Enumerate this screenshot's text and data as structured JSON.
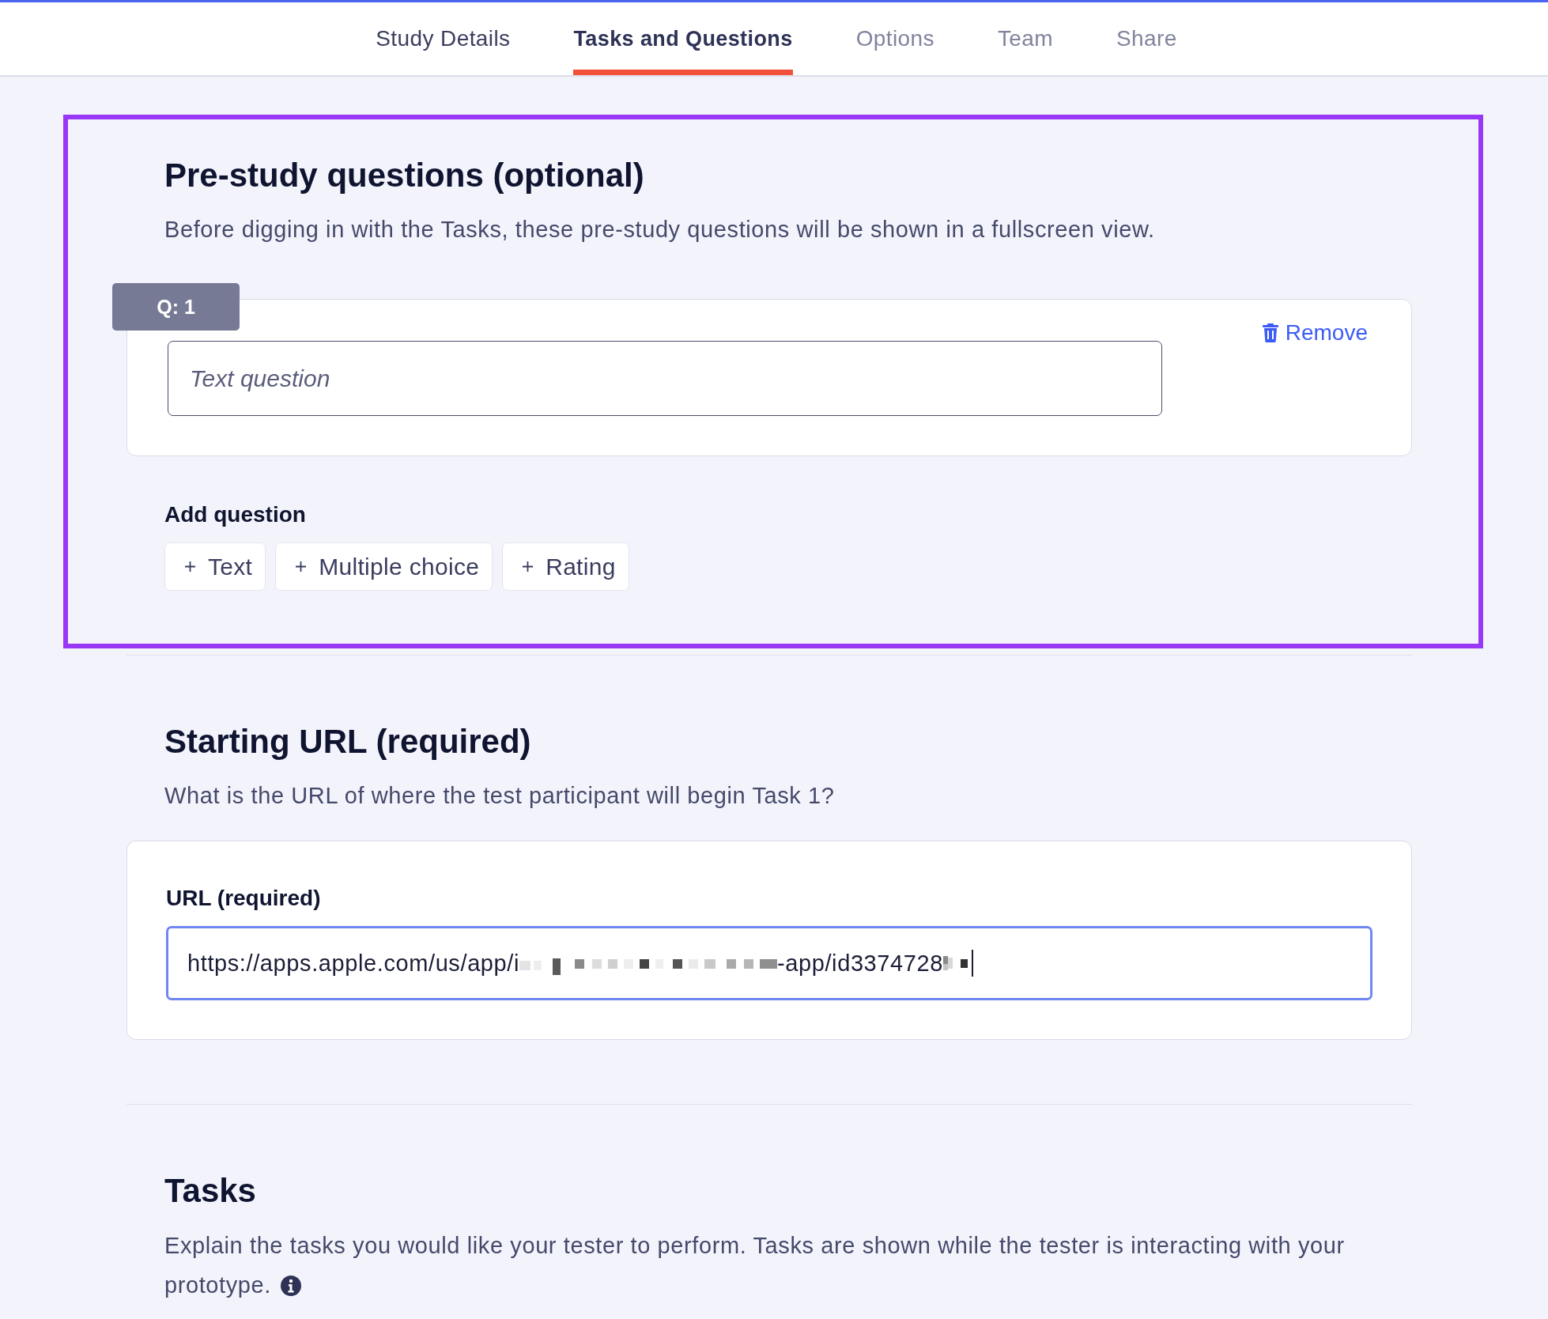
{
  "tabs": [
    {
      "label": "Study Details",
      "selected": false,
      "disabled": false
    },
    {
      "label": "Tasks and Questions",
      "selected": true,
      "disabled": false
    },
    {
      "label": "Options",
      "selected": false,
      "disabled": true
    },
    {
      "label": "Team",
      "selected": false,
      "disabled": true
    },
    {
      "label": "Share",
      "selected": false,
      "disabled": true
    }
  ],
  "pre_study": {
    "highlighted": true,
    "title": "Pre-study questions (optional)",
    "description": "Before digging in with the Tasks, these pre-study questions will be shown in a fullscreen view.",
    "questions": [
      {
        "badge": "Q: 1",
        "placeholder": "Text question",
        "remove_label": "Remove"
      }
    ],
    "add_question": {
      "label": "Add question",
      "buttons": [
        "Text",
        "Multiple choice",
        "Rating"
      ]
    }
  },
  "starting_url": {
    "title": "Starting URL (required)",
    "description": "What is the URL of where the test participant will begin Task 1?",
    "field": {
      "label": "URL (required)",
      "focused": true,
      "value_parts": [
        {
          "kind": "text",
          "text": "https://apps.apple.com/us/app/i"
        },
        {
          "kind": "redacted"
        },
        {
          "kind": "text",
          "text": "-app/id3374728"
        },
        {
          "kind": "redacted"
        }
      ]
    }
  },
  "tasks": {
    "title": "Tasks",
    "description": "Explain the tasks you would like your tester to perform. Tasks are shown while the tester is interacting with your prototype."
  }
}
